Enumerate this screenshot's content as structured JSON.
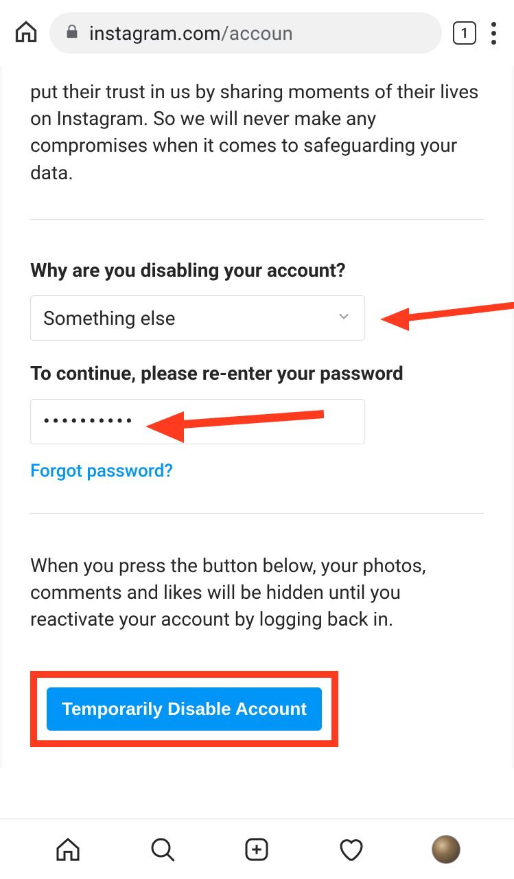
{
  "browser": {
    "url_domain": "instagram.com",
    "url_path": "/accoun",
    "tab_count": "1"
  },
  "content": {
    "intro": "put their trust in us by sharing moments of their lives on Instagram. So we will never make any compromises when it comes to safeguarding your data.",
    "question_heading": "Why are you disabling your account?",
    "reason_selected": "Something else",
    "password_heading": "To continue, please re-enter your password",
    "password_masked": "••••••••••",
    "forgot_link": "Forgot password?",
    "info": "When you press the button below, your photos, comments and likes will be hidden until you reactivate your account by logging back in.",
    "disable_button": "Temporarily Disable Account"
  }
}
